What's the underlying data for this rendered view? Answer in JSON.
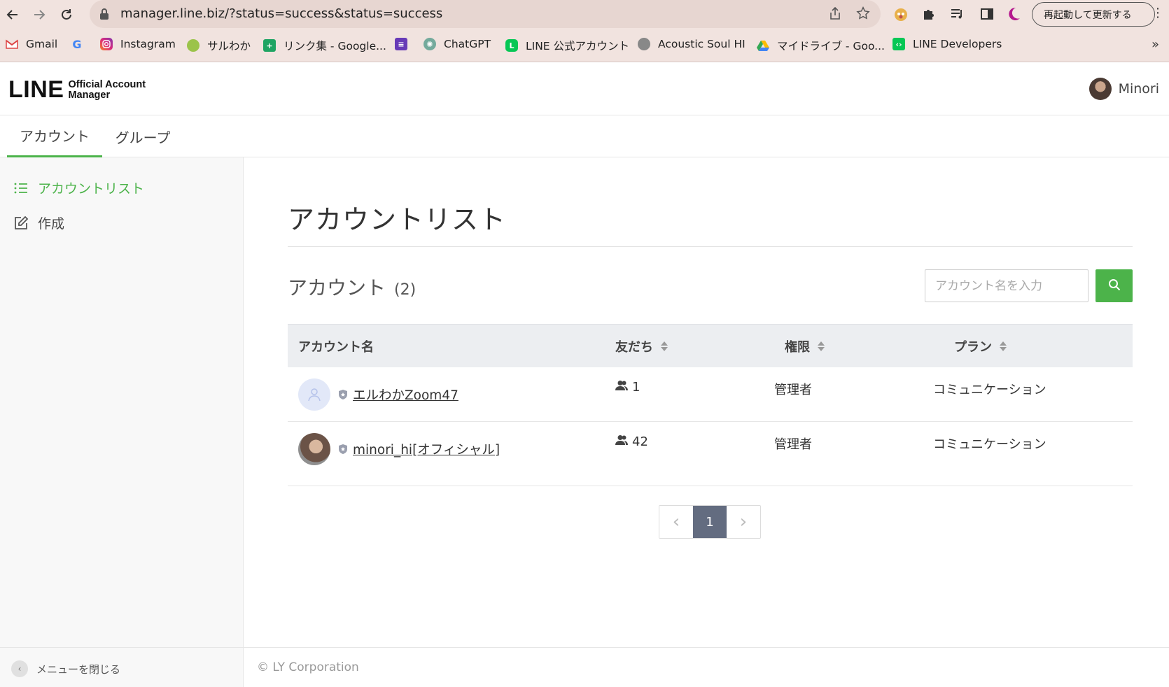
{
  "browser": {
    "url": "manager.line.biz/?status=success&status=success",
    "update_button": "再起動して更新する",
    "bookmarks": [
      {
        "label": "Gmail",
        "icon": "gmail-icon"
      },
      {
        "label": "",
        "icon": "google-icon"
      },
      {
        "label": "Instagram",
        "icon": "instagram-icon"
      },
      {
        "label": "サルわか",
        "icon": "saruwaka-icon"
      },
      {
        "label": "リンク集 - Google...",
        "icon": "sheets-icon"
      },
      {
        "label": "",
        "icon": "forms-icon"
      },
      {
        "label": "ChatGPT",
        "icon": "chatgpt-icon"
      },
      {
        "label": "LINE 公式アカウント",
        "icon": "line-icon"
      },
      {
        "label": "Acoustic Soul HI",
        "icon": "acoustic-icon"
      },
      {
        "label": "マイドライブ - Goo...",
        "icon": "drive-icon"
      },
      {
        "label": "LINE Developers",
        "icon": "line-dev-icon"
      }
    ],
    "bookmarks_more": "»"
  },
  "header": {
    "logo_main": "LINE",
    "logo_sub_1": "Official Account",
    "logo_sub_2": "Manager",
    "user_name": "Minori"
  },
  "tabs": [
    {
      "label": "アカウント",
      "active": true
    },
    {
      "label": "グループ",
      "active": false
    }
  ],
  "sidebar": {
    "items": [
      {
        "label": "アカウントリスト",
        "icon": "list-icon",
        "active": true
      },
      {
        "label": "作成",
        "icon": "edit-icon",
        "active": false
      }
    ],
    "close_menu": "メニューを閉じる"
  },
  "main": {
    "page_title": "アカウントリスト",
    "section_title": "アカウント",
    "section_count": "(2)",
    "search_placeholder": "アカウント名を入力",
    "columns": [
      "アカウント名",
      "友だち",
      "権限",
      "プラン"
    ],
    "rows": [
      {
        "name": "エルわかZoom47",
        "friends": "1",
        "role": "管理者",
        "plan": "コミュニケーション",
        "avatar": "default"
      },
      {
        "name": "minori_hi[オフィシャル]",
        "friends": "42",
        "role": "管理者",
        "plan": "コミュニケーション",
        "avatar": "photo"
      }
    ],
    "pagination": {
      "prev": "‹",
      "current": "1",
      "next": "›"
    }
  },
  "footer": {
    "copyright": "© LY Corporation"
  },
  "colors": {
    "accent": "#4cb34a",
    "chrome": "#f1e3df",
    "pager_active": "#636c80"
  }
}
